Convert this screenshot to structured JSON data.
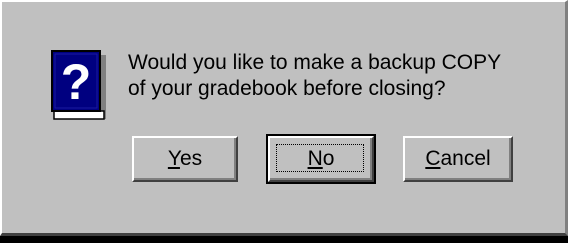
{
  "dialog": {
    "icon": "question-book-icon",
    "message_line1": "Would you like to make a backup COPY",
    "message_line2": "of your gradebook before closing?"
  },
  "buttons": {
    "yes": {
      "mnemonic": "Y",
      "rest": "es"
    },
    "no": {
      "mnemonic": "N",
      "rest": "o"
    },
    "cancel": {
      "mnemonic": "C",
      "rest": "ancel"
    }
  },
  "colors": {
    "face": "#c0c0c0",
    "icon_blue": "#000080",
    "icon_question": "#ffffff"
  }
}
